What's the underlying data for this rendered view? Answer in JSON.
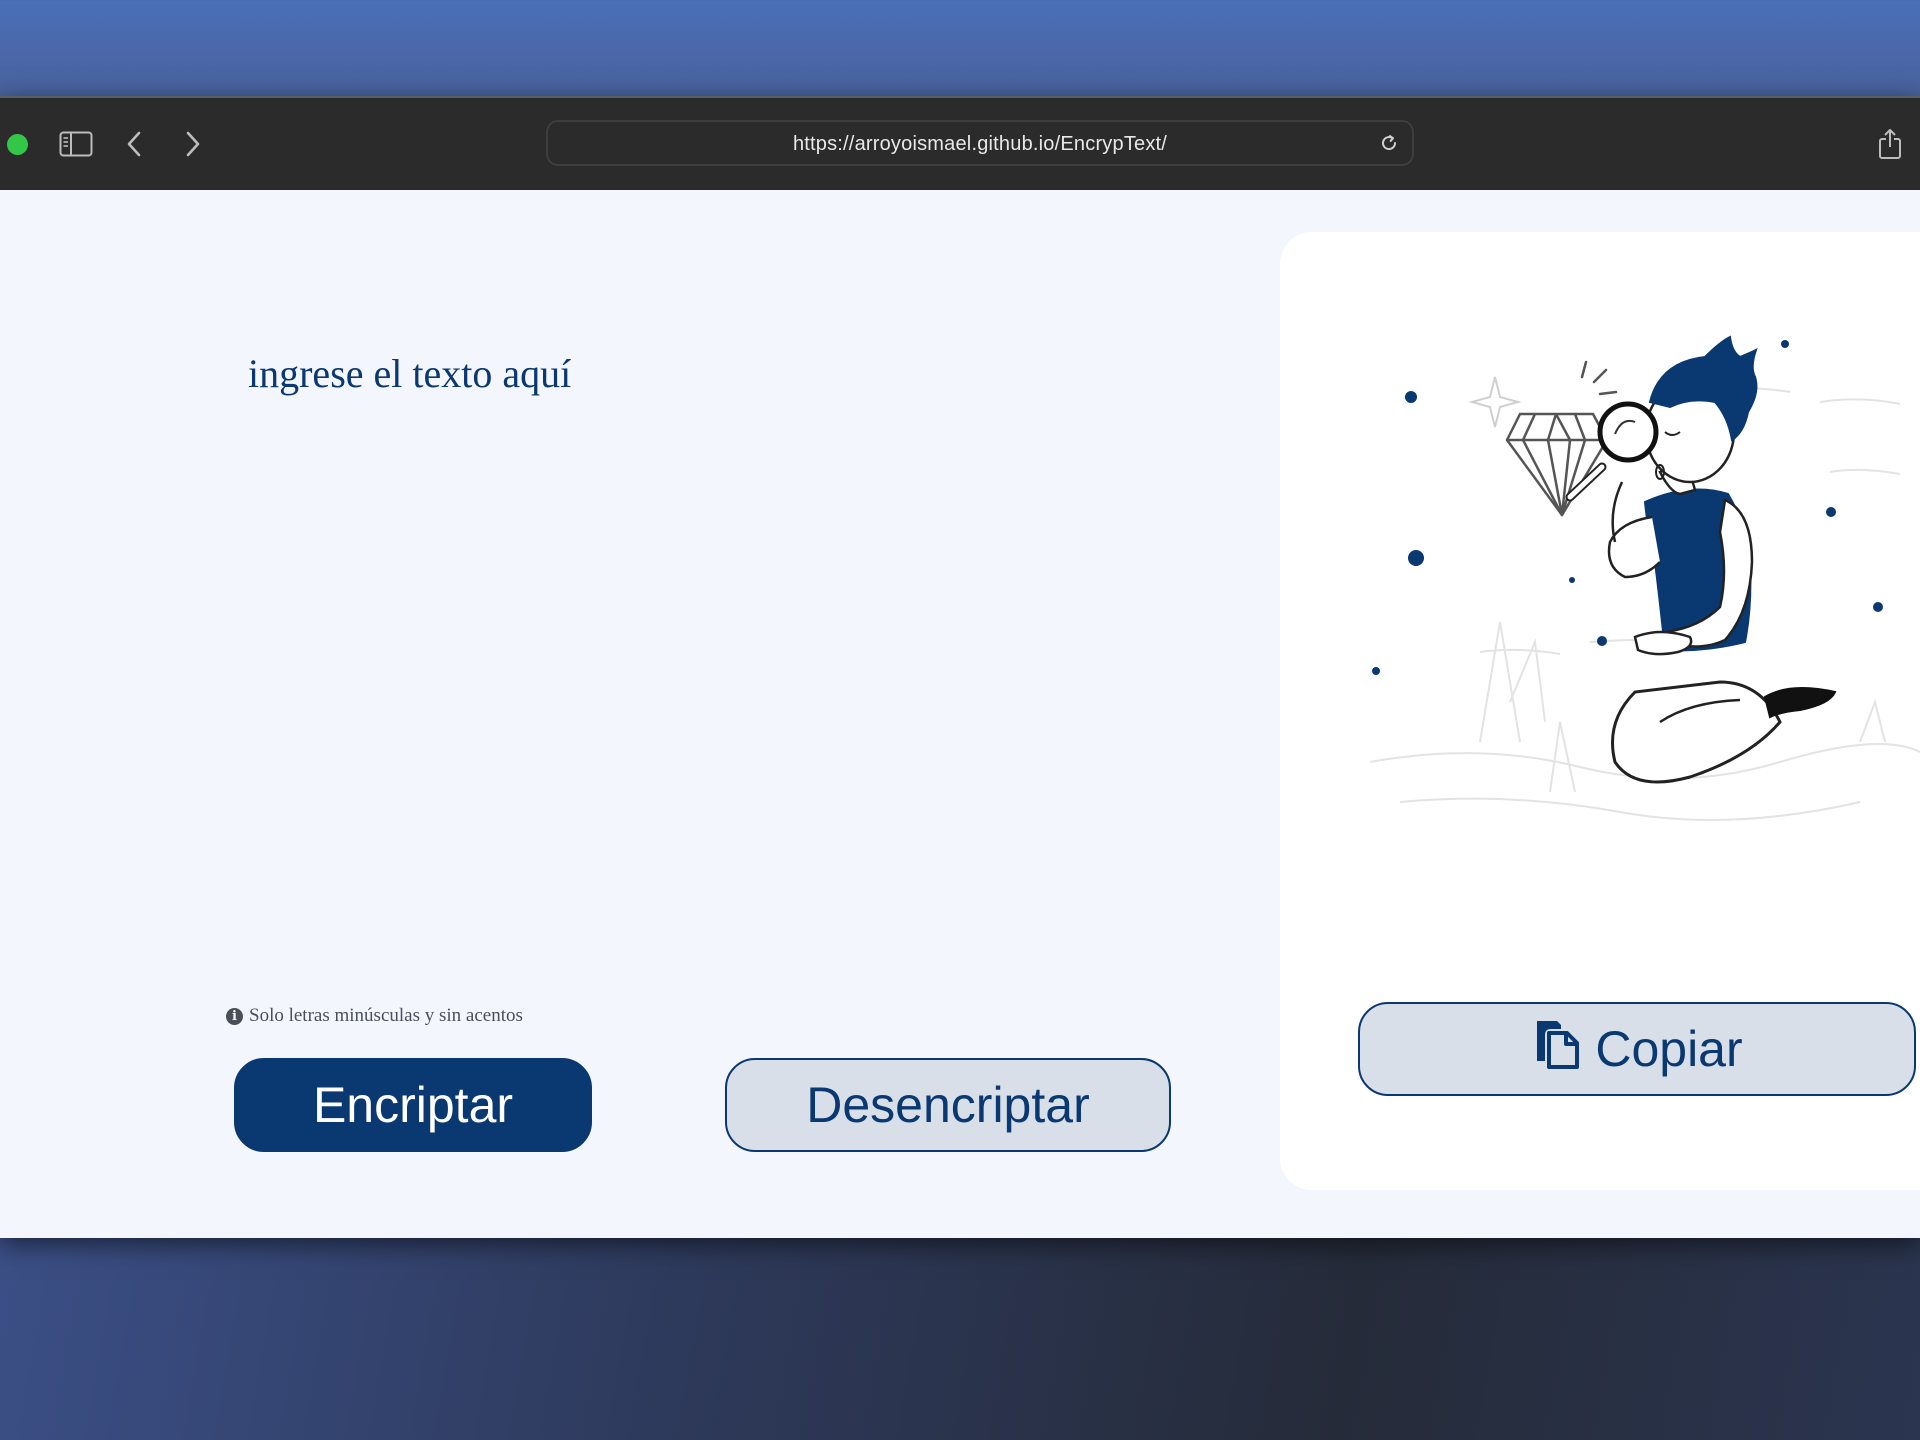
{
  "browser": {
    "url": "https://arroyoismael.github.io/EncrypText/",
    "icons": {
      "sidebar": "sidebar-icon",
      "back": "chevron-left-icon",
      "forward": "chevron-right-icon",
      "reload": "reload-icon",
      "share": "share-icon"
    }
  },
  "main": {
    "input_placeholder": "ingrese el texto aquí",
    "hint": "Solo letras minúsculas y sin acentos",
    "encrypt_label": "Encriptar",
    "decrypt_label": "Desencriptar"
  },
  "output": {
    "copy_label": "Copiar"
  },
  "colors": {
    "primary": "#0a3871",
    "secondary_bg": "#d8dfe8",
    "page_bg": "#f4f6fe",
    "panel_bg": "#ffffff"
  }
}
